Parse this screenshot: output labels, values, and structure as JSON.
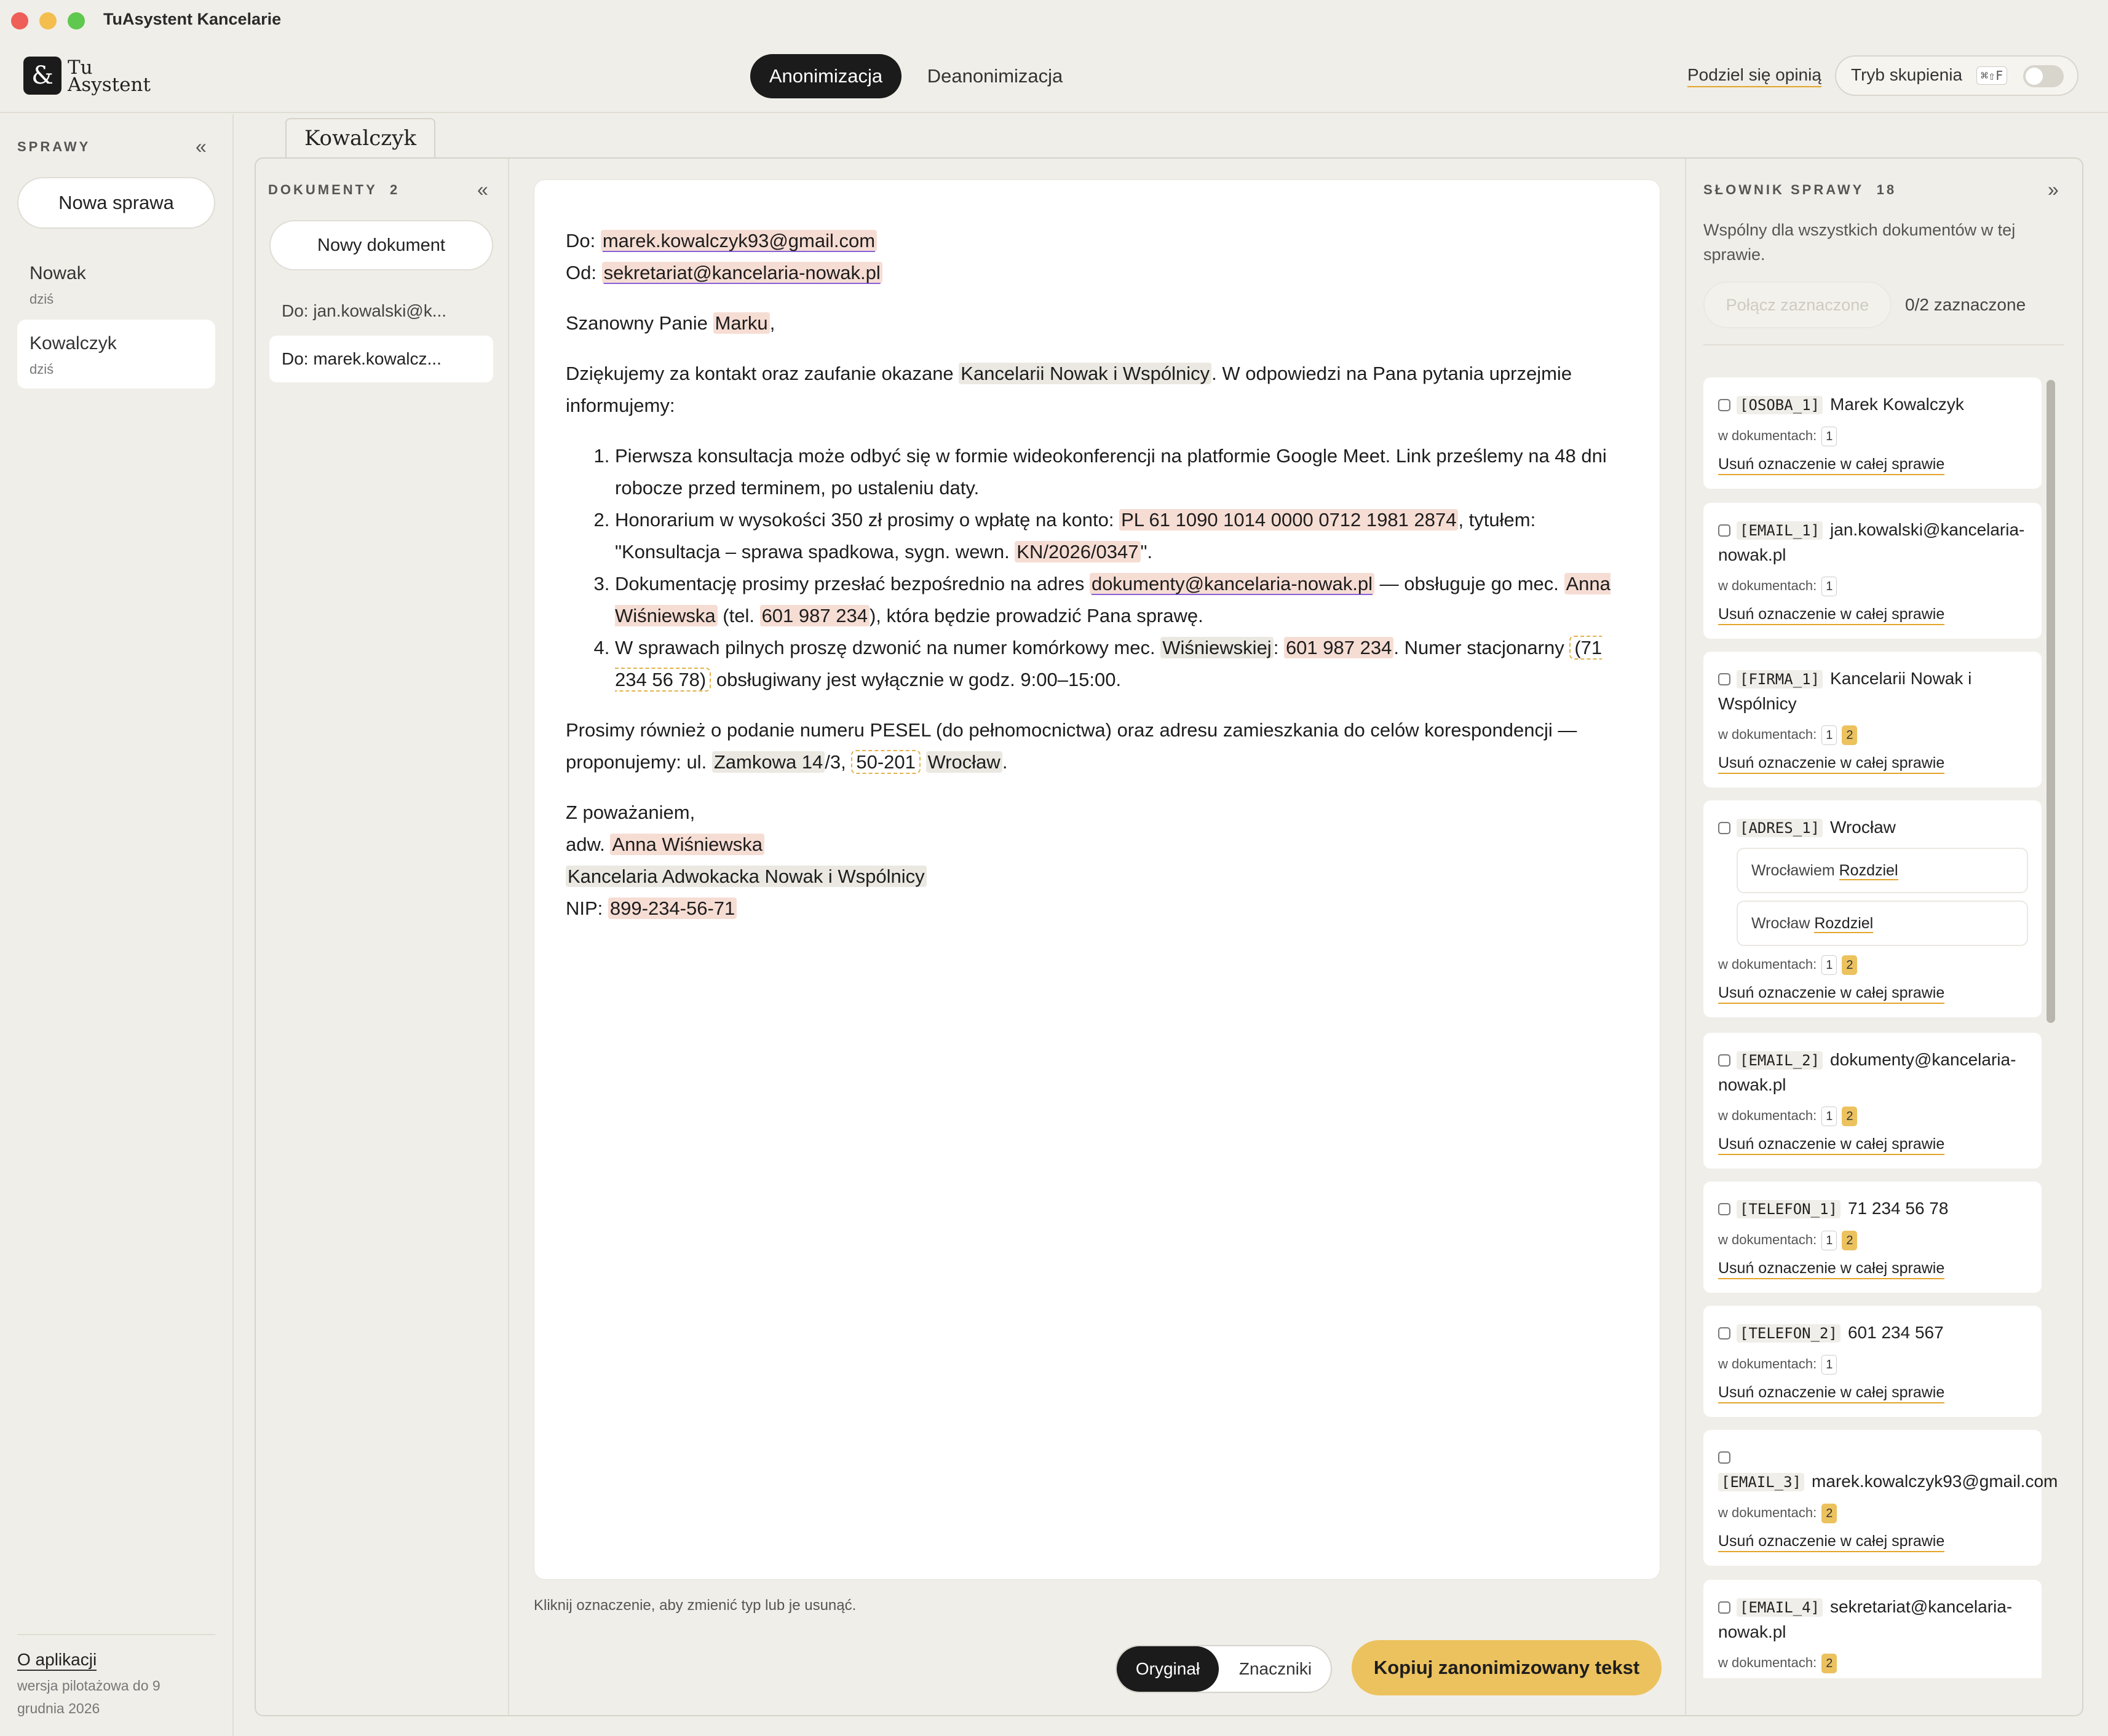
{
  "window": {
    "title": "TuAsystent Kancelarie"
  },
  "logo": {
    "glyph": "&",
    "line1": "Tu",
    "line2": "Asystent"
  },
  "nav": {
    "tab_anonymize": "Anonimizacja",
    "tab_deanonymize": "Deanonimizacja"
  },
  "header": {
    "feedback": "Podziel się opinią",
    "focus_label": "Tryb skupienia",
    "focus_shortcut": "⌘⇧F"
  },
  "sidebar": {
    "heading": "SPRAWY",
    "collapse": "«",
    "new_case": "Nowa sprawa",
    "cases": [
      {
        "name": "Nowak",
        "date": "dziś"
      },
      {
        "name": "Kowalczyk",
        "date": "dziś"
      }
    ],
    "about": "O aplikacji",
    "version": "wersja pilotażowa do 9 grudnia 2026"
  },
  "case_tab": "Kowalczyk",
  "documents": {
    "heading": "DOKUMENTY",
    "count": "2",
    "collapse": "«",
    "new_doc": "Nowy dokument",
    "items": [
      "Do: jan.kowalski@k...",
      "Do: marek.kowalcz..."
    ]
  },
  "editor": {
    "to_label": "Do: ",
    "to_email": "marek.kowalczyk93@gmail.com",
    "from_label": "Od: ",
    "from_email": "sekretariat@kancelaria-nowak.pl",
    "greeting_pre": "Szanowny Panie ",
    "greeting_name": "Marku",
    "greeting_post": ",",
    "intro_pre": "Dziękujemy za kontakt oraz zaufanie okazane ",
    "intro_firm": "Kancelarii Nowak i Wspólnicy",
    "intro_post": ". W odpowiedzi na Pana pytania uprzejmie informujemy:",
    "li1": "Pierwsza konsultacja może odbyć się w formie wideokonferencji na platformie Google Meet. Link prześlemy na 48 dni robocze przed terminem, po ustaleniu daty.",
    "li2_pre": "Honorarium w wysokości 350 zł prosimy o wpłatę na konto: ",
    "li2_account": "PL 61 1090 1014 0000 0712 1981 2874",
    "li2_mid": ", tytułem: \"Konsultacja – sprawa spadkowa, sygn. wewn. ",
    "li2_ref": "KN/2026/0347",
    "li2_post": "\".",
    "li3_pre": "Dokumentację prosimy przesłać bezpośrednio na adres ",
    "li3_email": "dokumenty@kancelaria-nowak.pl",
    "li3_mid": " — obsługuje go mec. ",
    "li3_name": "Anna Wiśniewska",
    "li3_mid2": " (tel. ",
    "li3_phone": "601 987 234",
    "li3_post": "), która będzie prowadzić Pana sprawę.",
    "li4_pre": "W sprawach pilnych proszę dzwonić na numer komórkowy mec. ",
    "li4_name": "Wiśniewskiej",
    "li4_colon": ": ",
    "li4_phone": "601 987 234",
    "li4_mid": ". Numer stacjonarny ",
    "li4_landline": "(71 234 56 78)",
    "li4_post": " obsługiwany jest wyłącznie w godz. 9:00–15:00.",
    "pesel_pre": "Prosimy również o podanie numeru PESEL (do pełnomocnictwa) oraz adresu zamieszkania do celów korespondencji — proponujemy: ul. ",
    "street": "Zamkowa 14",
    "flat": "/3, ",
    "zip": "50-201",
    "space": " ",
    "city": "Wrocław",
    "dot": ".",
    "closing": "Z poważaniem,",
    "sig_pre": "adw. ",
    "sig_name": "Anna Wiśniewska",
    "sig_firm": "Kancelaria Adwokacka Nowak i Wspólnicy",
    "nip_label": "NIP: ",
    "nip": "899-234-56-71"
  },
  "hint": "Kliknij oznaczenie, aby zmienić typ lub je usunąć.",
  "view_toggle": {
    "original": "Oryginał",
    "tags": "Znaczniki"
  },
  "copy_button": "Kopiuj zanonimizowany tekst",
  "dictionary": {
    "heading": "SŁOWNIK SPRAWY",
    "count": "18",
    "expand": "»",
    "description": "Wspólny dla wszystkich dokumentów w tej sprawie.",
    "merge": "Połącz zaznaczone",
    "selected": "0/2 zaznaczone",
    "in_docs_label": "w dokumentach:",
    "remove_label": "Usuń oznaczenie w całej sprawie",
    "split_label": "Rozdziel",
    "entries": [
      {
        "tag": "[OSOBA_1]",
        "value": "Marek Kowalczyk",
        "docs": [
          "1"
        ]
      },
      {
        "tag": "[EMAIL_1]",
        "value": "jan.kowalski@kancelaria-nowak.pl",
        "docs": [
          "1"
        ]
      },
      {
        "tag": "[FIRMA_1]",
        "value": "Kancelarii Nowak i Wspólnicy",
        "docs": [
          "1",
          "2"
        ]
      },
      {
        "tag": "[ADRES_1]",
        "value": "Wrocław",
        "variants": [
          "Wrocławiem",
          "Wrocław"
        ],
        "docs": [
          "1",
          "2"
        ]
      },
      {
        "tag": "[EMAIL_2]",
        "value": "dokumenty@kancelaria-nowak.pl",
        "docs": [
          "1",
          "2"
        ]
      },
      {
        "tag": "[TELEFON_1]",
        "value": "71 234 56 78",
        "docs": [
          "1",
          "2"
        ]
      },
      {
        "tag": "[TELEFON_2]",
        "value": "601 234 567",
        "docs": [
          "1"
        ]
      },
      {
        "tag": "[EMAIL_3]",
        "value": "marek.kowalczyk93@gmail.com",
        "docs": [
          "2"
        ]
      },
      {
        "tag": "[EMAIL_4]",
        "value": "sekretariat@kancelaria-nowak.pl",
        "docs": [
          "2"
        ]
      }
    ]
  }
}
